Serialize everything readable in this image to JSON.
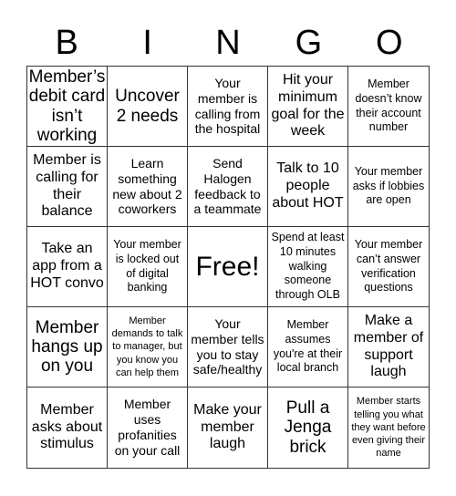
{
  "header": {
    "letters": [
      "B",
      "I",
      "N",
      "G",
      "O"
    ]
  },
  "board": {
    "cells": [
      "Member’s debit card isn’t working",
      "Uncover 2 needs",
      "Your member is calling from the hospital",
      "Hit your minimum goal for the week",
      "Member doesn’t know their account number",
      "Member is calling for their balance",
      "Learn something new about 2 coworkers",
      "Send Halogen feedback to a teammate",
      "Talk to 10 people about HOT",
      "Your member asks if lobbies are open",
      "Take an app from a HOT convo",
      "Your member is locked out of digital banking",
      "Free!",
      "Spend at least 10 minutes walking someone through OLB",
      "Your member can’t answer verification questions",
      "Member hangs up on you",
      "Member demands to talk to manager, but you know you can help them",
      "Your member tells you to stay safe/healthy",
      "Member assumes you're at their local branch",
      "Make a member of support laugh",
      "Member asks about stimulus",
      "Member uses profanities on your call",
      "Make your member laugh",
      "Pull a Jenga brick",
      "Member starts telling you what they want before even giving their name"
    ]
  }
}
